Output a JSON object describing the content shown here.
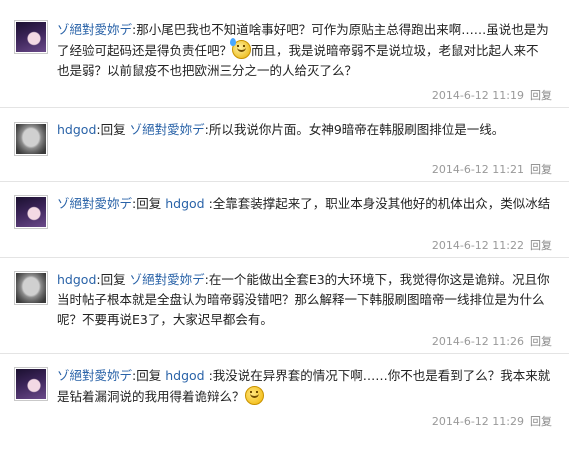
{
  "reply_label": "回复",
  "posts": [
    {
      "user": "ゾ絕對愛妳デ",
      "sep": ":",
      "text_a": "那小尾巴我也不知道啥事好吧？可作为原贴主总得跑出来啊……虽说也是为了经验可起码还是得负责任吧？",
      "emoji": "sweat-face-emoji",
      "text_b": "而且，我是说暗帝弱不是说垃圾，老鼠对比起人来不也是弱？以前鼠疫不也把欧洲三分之一的人给灭了么？",
      "time": "2014-6-12 11:19"
    },
    {
      "user": "hdgod",
      "sep": ":",
      "reply_prefix": "回复",
      "reply_to": "ゾ絕對愛妳デ",
      "text_a": ":所以我说你片面。女神9暗帝在韩服刷图排位是一线。",
      "time": "2014-6-12 11:21"
    },
    {
      "user": "ゾ絕對愛妳デ",
      "sep": ":",
      "reply_prefix": "回复",
      "reply_to": "hdgod",
      "text_a": ":全靠套装撑起来了，职业本身没其他好的机体出众，类似冰结",
      "time": "2014-6-12 11:22"
    },
    {
      "user": "hdgod",
      "sep": ":",
      "reply_prefix": "回复",
      "reply_to": "ゾ絕對愛妳デ",
      "text_a": ":在一个能做出全套E3的大环境下，我觉得你这是诡辩。况且你当时帖子根本就是全盘认为暗帝弱没错吧？那么解释一下韩服刷图暗帝一线排位是为什么呢？不要再说E3了，大家迟早都会有。",
      "time": "2014-6-12 11:26"
    },
    {
      "user": "ゾ絕對愛妳デ",
      "sep": ":",
      "reply_prefix": "回复",
      "reply_to": "hdgod",
      "text_a": ":我没说在异界套的情况下啊……你不也是看到了么？我本来就是钻着漏洞说的我用得着诡辩么？",
      "emoji": "grin-face-emoji",
      "time": "2014-6-12 11:29"
    }
  ]
}
